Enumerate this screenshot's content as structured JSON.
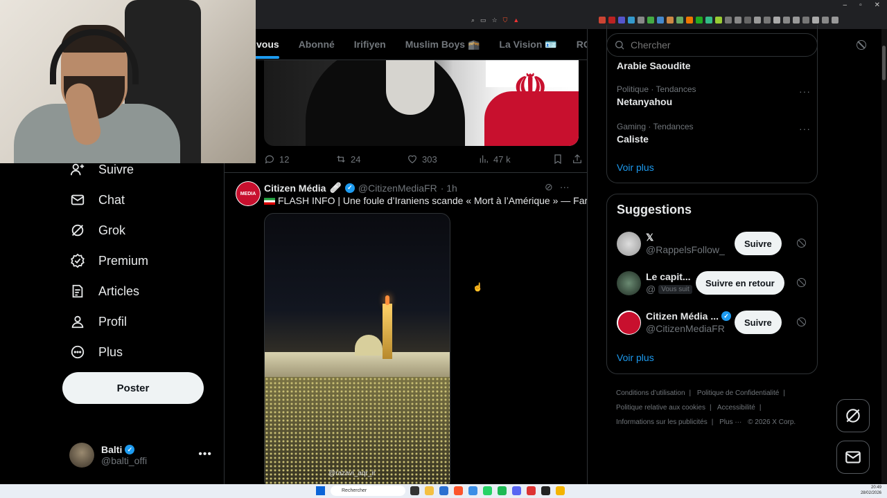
{
  "browser": {
    "window_controls": [
      "–",
      "▫",
      "✕"
    ]
  },
  "tabs": [
    {
      "label": "vous",
      "active": true
    },
    {
      "label": "Abonné"
    },
    {
      "label": "Irifiyen"
    },
    {
      "label": "Muslim Boys 🕋"
    },
    {
      "label": "La Vision 🪪"
    },
    {
      "label": "ROAD "
    }
  ],
  "nav": {
    "items": [
      {
        "label": "Suivre",
        "icon": "add-user-icon"
      },
      {
        "label": "Chat",
        "icon": "mail-icon"
      },
      {
        "label": "Grok",
        "icon": "grok-icon"
      },
      {
        "label": "Premium",
        "icon": "verified-badge-icon"
      },
      {
        "label": "Articles",
        "icon": "article-icon"
      },
      {
        "label": "Profil",
        "icon": "profile-icon"
      },
      {
        "label": "Plus",
        "icon": "more-circle-icon"
      }
    ],
    "post_label": "Poster",
    "account": {
      "name": "Balti",
      "handle": "@balti_offi",
      "more": "•••"
    }
  },
  "prev_tweet": {
    "replies": "12",
    "reposts": "24",
    "likes": "303",
    "views": "47 k"
  },
  "tweet": {
    "avatar_text": "MEDIA",
    "name": "Citizen Média",
    "name_emoji": "🩹",
    "handle": "@CitizenMediaFR",
    "time": "· 1h",
    "text": "FLASH INFO | Une foule d’Iraniens scande « Mort à l’Amérique » — Fars",
    "video_watermark": "@razavi_aqr_ir"
  },
  "search": {
    "placeholder": "Chercher"
  },
  "trends": [
    {
      "meta": "",
      "topic": "Arabie Saoudite"
    },
    {
      "meta": "Politique · Tendances",
      "topic": "Netanyahou"
    },
    {
      "meta": "Gaming · Tendances",
      "topic": "Caliste"
    }
  ],
  "trends_more": "Voir plus",
  "suggestions": {
    "title": "Suggestions",
    "items": [
      {
        "name": "𝕏",
        "handle": "@RappelsFollow_",
        "button": "Suivre",
        "follows_you": ""
      },
      {
        "name": "Le capit...",
        "handle": "@",
        "button": "Suivre en retour",
        "follows_you": "Vous suit"
      },
      {
        "name": "Citizen Média ...",
        "handle": "@CitizenMediaFR",
        "button": "Suivre",
        "follows_you": "",
        "verified": true
      }
    ],
    "more": "Voir plus"
  },
  "footer": {
    "links": [
      "Conditions d’utilisation",
      "|",
      "Politique de Confidentialité",
      "|",
      "Politique relative aux cookies",
      "|",
      "Accessibilité",
      "|",
      "Informations sur les publicités",
      "|",
      "Plus ···",
      "© 2026 X Corp."
    ]
  },
  "taskbar": {
    "search_placeholder": "Rechercher",
    "time": "20:49",
    "date": "28/02/2026"
  },
  "colors": {
    "accent": "#1d9bf0",
    "background": "#000000",
    "text": "#e7e9ea",
    "muted": "#71767b",
    "border": "#2f3336"
  }
}
